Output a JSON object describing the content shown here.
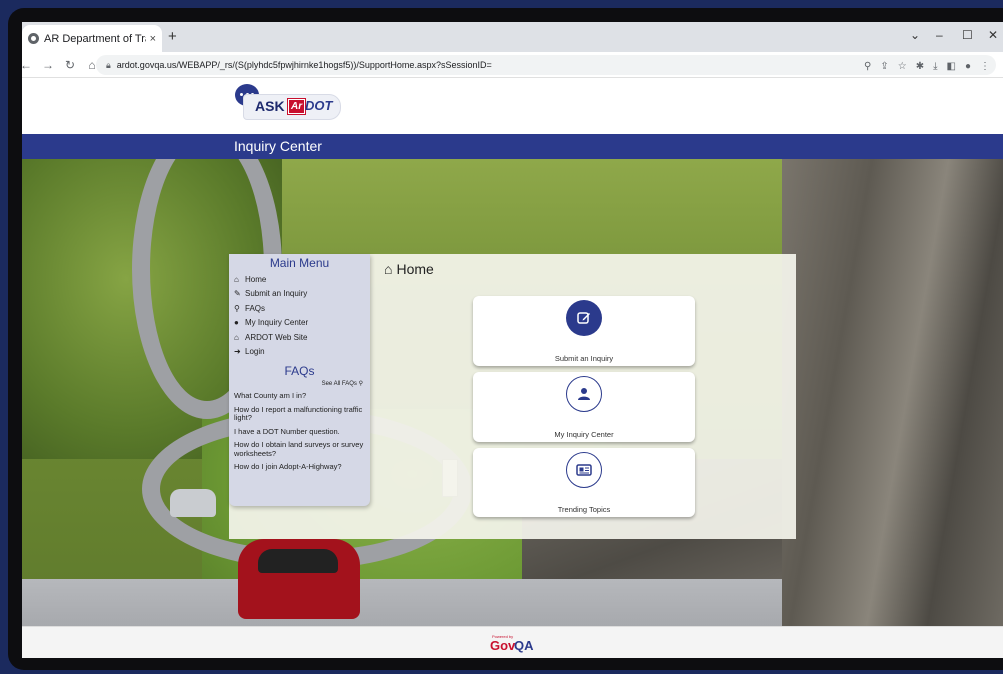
{
  "browser": {
    "tab_title": "AR Department of Transp",
    "tab_close": "×",
    "new_tab": "+",
    "url": "ardot.govqa.us/WEBAPP/_rs/(S(plyhdc5fpwjhirnke1hogsf5))/SupportHome.aspx?sSessionID=",
    "window_controls": [
      "⌄",
      "–",
      "☐",
      "✕"
    ]
  },
  "header": {
    "logo_text_ask": "ASK",
    "logo_text_ar": "Ar",
    "logo_text_dot": "DOT",
    "bar_title": "Inquiry Center"
  },
  "menu": {
    "title": "Main Menu",
    "items": [
      {
        "label": "Home",
        "icon": "home-icon"
      },
      {
        "label": "Submit an Inquiry",
        "icon": "edit-icon"
      },
      {
        "label": "FAQs",
        "icon": "search-icon"
      },
      {
        "label": "My Inquiry Center",
        "icon": "user-icon"
      },
      {
        "label": "ARDOT Web Site",
        "icon": "home-icon"
      },
      {
        "label": "Login",
        "icon": "sign-in-icon"
      }
    ],
    "faqs_title": "FAQs",
    "see_all": "See All FAQs",
    "faq_items": [
      "What County am I in?",
      "How do I report a malfunctioning traffic light?",
      "I have a DOT Number question.",
      "How do I obtain land surveys or survey worksheets?",
      "How do I join Adopt-A-Highway?"
    ]
  },
  "main": {
    "page_title": "Home",
    "cards": [
      {
        "label": "Submit an Inquiry",
        "icon": "edit-icon"
      },
      {
        "label": "My Inquiry Center",
        "icon": "user-icon"
      },
      {
        "label": "Trending Topics",
        "icon": "newspaper-icon"
      }
    ]
  },
  "footer": {
    "powered_by": "Powered by",
    "gov": "Gov",
    "qa": "QA"
  },
  "colors": {
    "brand_blue": "#2b3a8c",
    "brand_red": "#c8102e"
  }
}
